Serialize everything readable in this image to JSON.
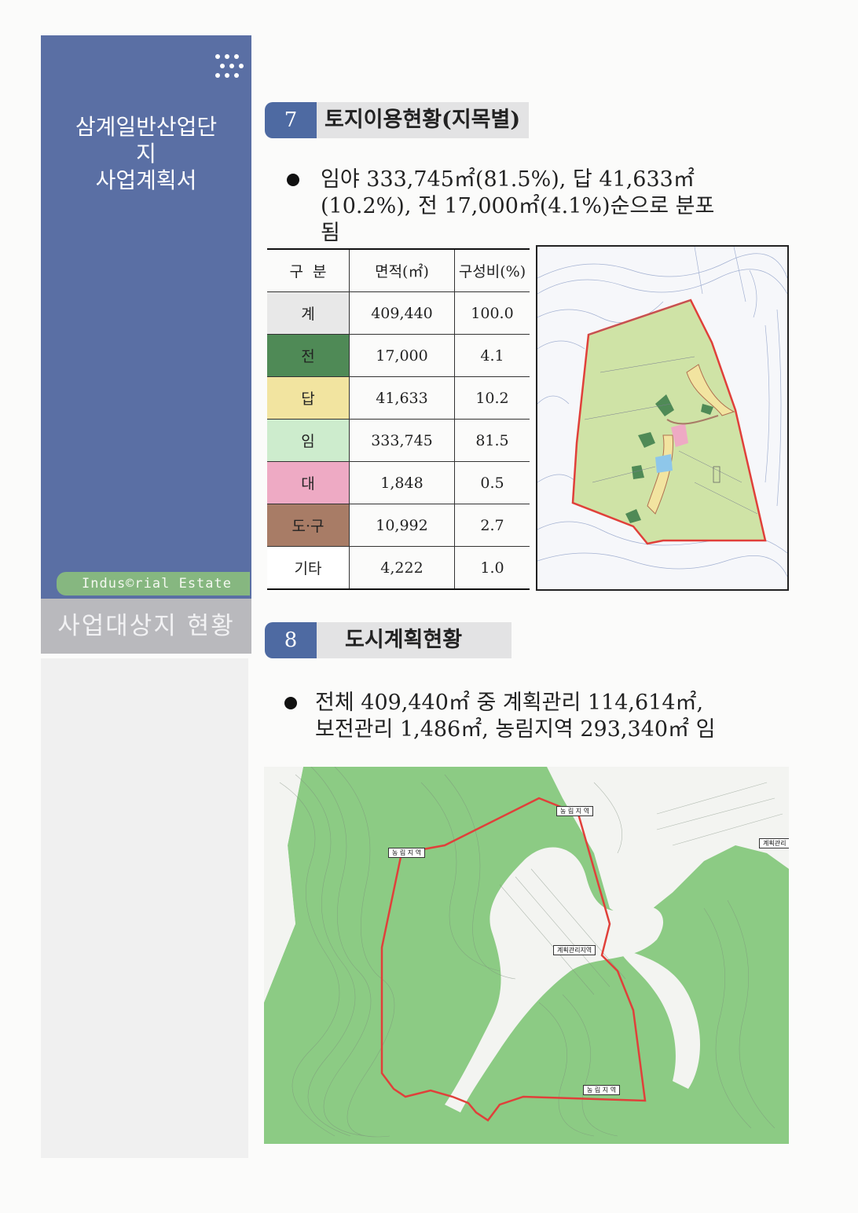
{
  "sidebar": {
    "title_lines": [
      "삼계일반산업단",
      "지",
      "사업계획서"
    ],
    "tag": "Indus©rial Estate",
    "section": "사업대상지 현황"
  },
  "section7": {
    "number": "7",
    "title": "토지이용현황(지목별)",
    "bullet_lines": [
      "임야 333,745㎡(81.5%), 답 41,633㎡",
      "(10.2%), 전 17,000㎡(4.1%)순으로 분포",
      "됨"
    ],
    "table": {
      "headers": [
        "구  분",
        "면적(㎡)",
        "구성비(%)"
      ],
      "rows": [
        {
          "label": "계",
          "area": "409,440",
          "ratio": "100.0",
          "color": "#e8e8e8"
        },
        {
          "label": "전",
          "area": "17,000",
          "ratio": "4.1",
          "color": "#4f8a56"
        },
        {
          "label": "답",
          "area": "41,633",
          "ratio": "10.2",
          "color": "#f2e4a0"
        },
        {
          "label": "임",
          "area": "333,745",
          "ratio": "81.5",
          "color": "#cdeccd"
        },
        {
          "label": "대",
          "area": "1,848",
          "ratio": "0.5",
          "color": "#eeaac4"
        },
        {
          "label": "도·구",
          "area": "10,992",
          "ratio": "2.7",
          "color": "#a87c66"
        },
        {
          "label": "기타",
          "area": "4,222",
          "ratio": "1.0",
          "color": "#ffffff"
        }
      ]
    }
  },
  "section8": {
    "number": "8",
    "title": "도시계획현황",
    "bullet_lines": [
      "전체 409,440㎡ 중 계획관리 114,614㎡,",
      "보전관리 1,486㎡, 농림지역 293,340㎡ 임"
    ],
    "map_labels": {
      "north": "농 림 지 역",
      "west": "농 림 지 역",
      "east_edge": "계획관리",
      "center": "계획관리지역",
      "south": "농 림 지 역"
    }
  },
  "colors": {
    "sidebar_blue": "#5a6fa4",
    "accent_green": "#86b780",
    "section_gray": "#b9b9bd",
    "boundary_red": "#e0403a",
    "forest_green": "#8ccb84",
    "parcel_green": "#cfe3a6"
  }
}
